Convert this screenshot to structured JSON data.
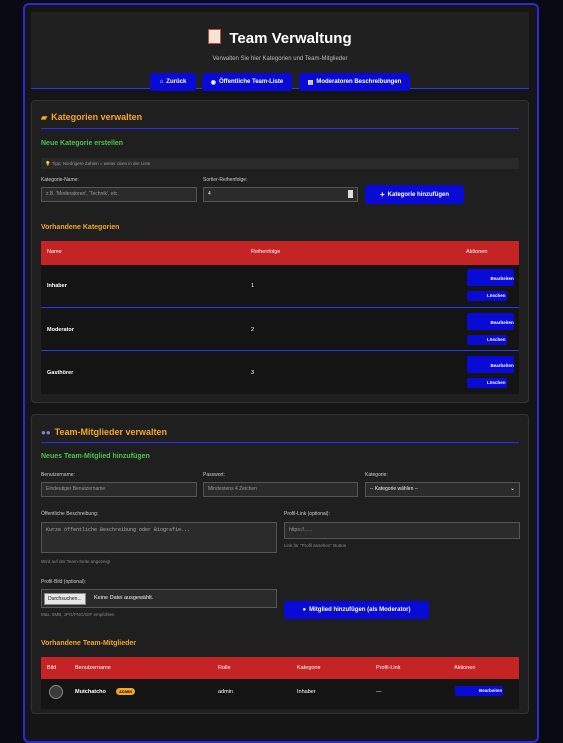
{
  "header": {
    "title": "Team Verwaltung",
    "subtitle": "Verwalten Sie hier Kategorien und Team-Mitglieder",
    "nav": [
      {
        "icon": "home-icon",
        "label": "Zurück"
      },
      {
        "icon": "eye-icon",
        "label": "Öffentliche Team-Liste"
      },
      {
        "icon": "document-icon",
        "label": "Moderatoren Beschreibungen"
      }
    ]
  },
  "categories": {
    "title": "Kategorien verwalten",
    "new_title": "Neue Kategorie erstellen",
    "tip": "💡 Tipp: Niedrigere Zahlen = weiter oben in der Liste",
    "name_label": "Kategorie-Name:",
    "name_placeholder": "z.B. 'Moderatoren', 'Technik', etc.",
    "order_label": "Sortier-Reihenfolge:",
    "order_value": "4",
    "add_button": "Kategorie hinzufügen",
    "existing_title": "Vorhandene Kategorien",
    "columns": [
      "Name",
      "Reihenfolge",
      "Aktionen"
    ],
    "rows": [
      {
        "name": "Inhaber",
        "order": "1"
      },
      {
        "name": "Moderator",
        "order": "2"
      },
      {
        "name": "Gasthörer",
        "order": "3"
      }
    ],
    "edit_label": "Bearbeiten",
    "delete_label": "Löschen"
  },
  "members": {
    "title": "Team-Mitglieder verwalten",
    "new_title": "Neues Team-Mitglied hinzufügen",
    "username_label": "Benutzername:",
    "username_placeholder": "Eindeutiger Benutzername",
    "password_label": "Passwort:",
    "password_placeholder": "Mindestens 4 Zeichen",
    "category_label": "Kategorie:",
    "category_value": "-- Kategorie wählen --",
    "desc_label": "Öffentliche Beschreibung:",
    "desc_placeholder": "Kurze öffentliche Beschreibung oder Biografie...",
    "desc_hint": "Wird auf der Team-Seite angezeigt",
    "profile_label": "Profil-Link (optional):",
    "profile_placeholder": "https://......",
    "profile_hint": "Link für \"Profil ansehen\" Button",
    "picture_label": "Profil-Bild (optional):",
    "file_button": "Durchsuchen...",
    "file_text": "Keine Datei ausgewählt.",
    "picture_hint": "Max. 5MB, JPG/PNG/GIF empfohlen",
    "add_button": "Mitglied hinzufügen (als Moderator)",
    "existing_title": "Vorhandene Team-Mitglieder",
    "columns": [
      "Bild",
      "Benutzername",
      "Rolle",
      "Kategorie",
      "Profil-Link",
      "Aktionen"
    ],
    "rows": [
      {
        "username": "Mutchatcho",
        "badge": "ADMIN",
        "role": "admin",
        "category": "Inhaber",
        "profile": "—",
        "action": "Bearbeiten"
      }
    ]
  },
  "colors": {
    "accent": "#0a0ad6",
    "table_header": "#c42424",
    "heading_orange": "#f5a623",
    "heading_green": "#4cc24c"
  }
}
